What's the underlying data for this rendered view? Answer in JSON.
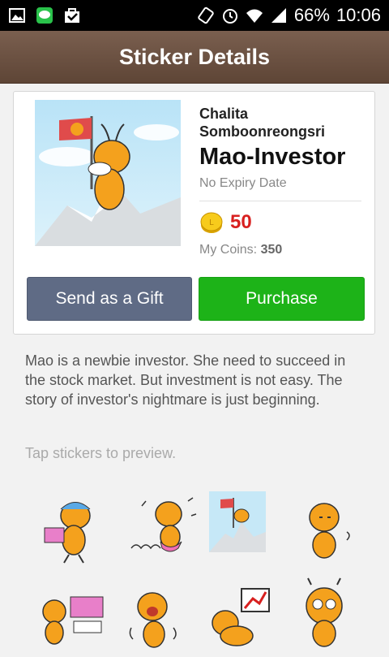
{
  "status_bar": {
    "battery": "66%",
    "time": "10:06",
    "icons": [
      "gallery-icon",
      "line-app-icon",
      "shopping-bag-icon",
      "rotate-icon",
      "alarm-icon",
      "wifi-icon",
      "signal-icon",
      "battery-icon"
    ]
  },
  "header": {
    "title": "Sticker Details"
  },
  "sticker": {
    "author": "Chalita Somboonreongsri",
    "title": "Mao-Investor",
    "expiry": "No Expiry Date",
    "price": "50",
    "my_coins_label": "My Coins:",
    "my_coins_value": "350"
  },
  "buttons": {
    "gift": "Send as a Gift",
    "purchase": "Purchase"
  },
  "description": "Mao is a newbie investor. She need to succeed in the stock market. But investment is not easy. The story of investor's nightmare is just beginning.",
  "preview_hint": "Tap stickers to preview.",
  "sticker_grid": [
    {
      "name": "sticker-shopping"
    },
    {
      "name": "sticker-dancing"
    },
    {
      "name": "sticker-mountain-flag"
    },
    {
      "name": "sticker-thinking"
    },
    {
      "name": "sticker-sale"
    },
    {
      "name": "sticker-crying"
    },
    {
      "name": "sticker-chart-crash"
    },
    {
      "name": "sticker-shocked"
    }
  ],
  "colors": {
    "header": "#6b5040",
    "gift_button": "#5f6b85",
    "purchase_button": "#1db318",
    "price": "#d8201f"
  }
}
